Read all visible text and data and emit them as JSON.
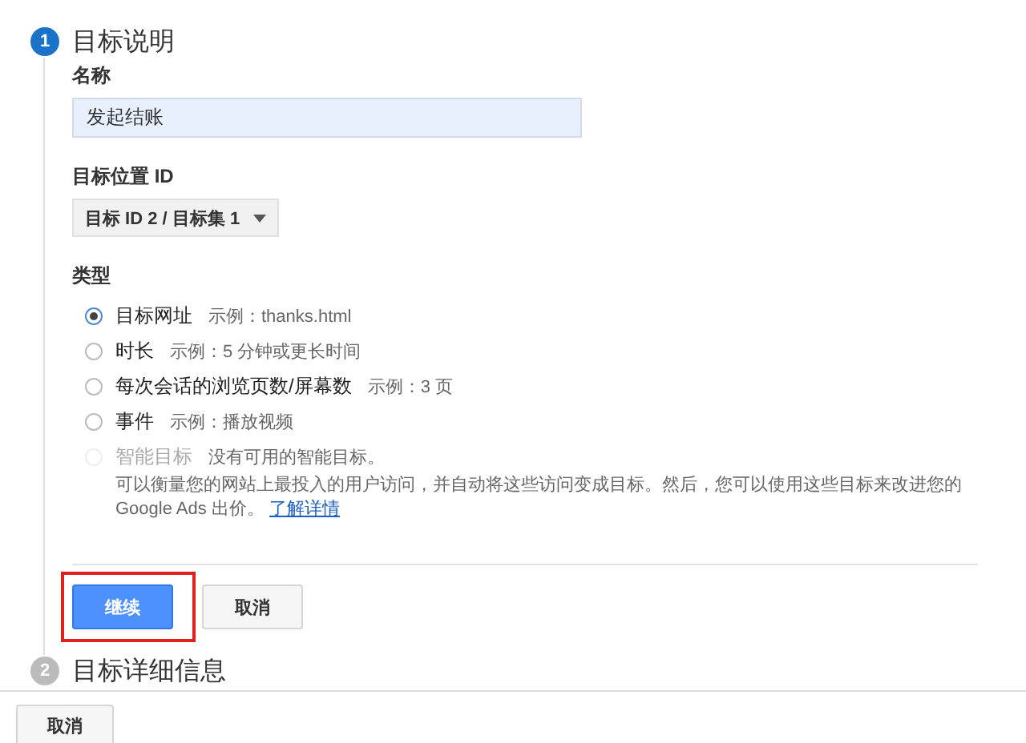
{
  "step_1": {
    "number": "1",
    "title": "目标说明",
    "active": true
  },
  "name_field": {
    "label": "名称",
    "value": "发起结账"
  },
  "goal_slot": {
    "label": "目标位置 ID",
    "value": "目标 ID 2 / 目标集 1"
  },
  "type": {
    "label": "类型",
    "options": [
      {
        "label": "目标网址",
        "example": "示例：thanks.html",
        "selected": true,
        "disabled": false
      },
      {
        "label": "时长",
        "example": "示例：5 分钟或更长时间",
        "selected": false,
        "disabled": false
      },
      {
        "label": "每次会话的浏览页数/屏幕数",
        "example": "示例：3 页",
        "selected": false,
        "disabled": false
      },
      {
        "label": "事件",
        "example": "示例：播放视频",
        "selected": false,
        "disabled": false
      },
      {
        "label": "智能目标",
        "example": "没有可用的智能目标。",
        "selected": false,
        "disabled": true
      }
    ],
    "note": "可以衡量您的网站上最投入的用户访问，并自动将这些访问变成目标。然后，您可以使用这些目标来改进您的 Google Ads 出价。",
    "note_link": "了解详情"
  },
  "continue_button": {
    "label": "继续",
    "highlighted": true
  },
  "cancel_button": "取消",
  "step_2": {
    "number": "2",
    "title": "目标详细信息",
    "active": false
  },
  "footer_cancel_button": "取消"
}
